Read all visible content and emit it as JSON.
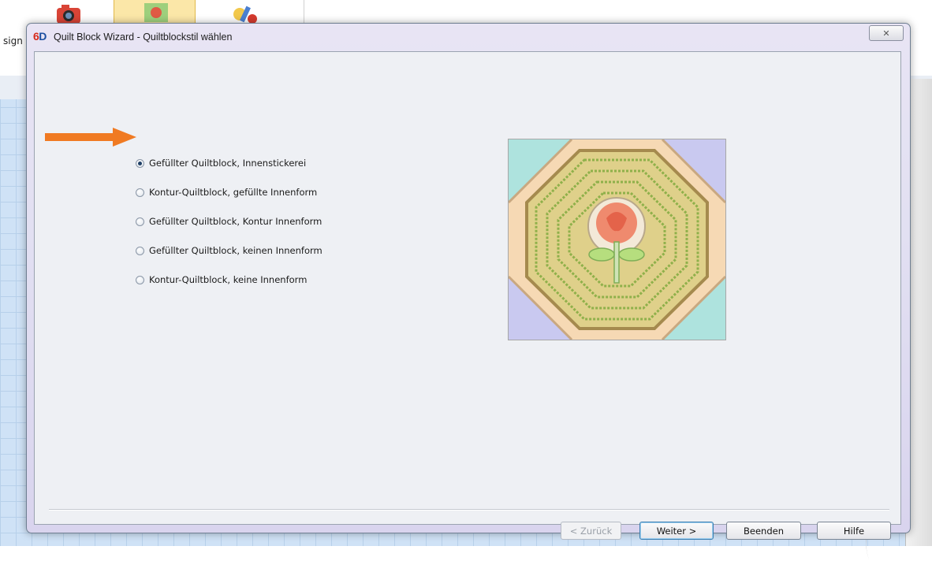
{
  "background_app": {
    "toolbar_buttons": [
      "camera-icon",
      "quilt-block-icon",
      "paint-tool-icon"
    ],
    "side_label": "sign"
  },
  "dialog": {
    "logo": {
      "red": "6",
      "blue": "D"
    },
    "title": "Quilt Block Wizard - Quiltblockstil wählen",
    "close_icon": "close-icon",
    "options": [
      {
        "label": "Gefüllter Quiltblock, Innenstickerei",
        "selected": true
      },
      {
        "label": "Kontur-Quiltblock, gefüllte Innenform",
        "selected": false
      },
      {
        "label": "Gefüllter Quiltblock, Kontur Innenform",
        "selected": false
      },
      {
        "label": "Gefüllter Quiltblock, keinen Innenform",
        "selected": false
      },
      {
        "label": "Kontur-Quiltblock, keine Innenform",
        "selected": false
      }
    ],
    "preview_icon": "quilt-block-rose-preview",
    "buttons": {
      "back": "< Zurück",
      "next": "Weiter >",
      "finish": "Beenden",
      "help": "Hilfe"
    }
  },
  "colors": {
    "arrow": "#f07a22",
    "grid_background": "#cfe2f6",
    "title_logo_red": "#d62a1a",
    "title_logo_blue": "#1c4fa0"
  }
}
